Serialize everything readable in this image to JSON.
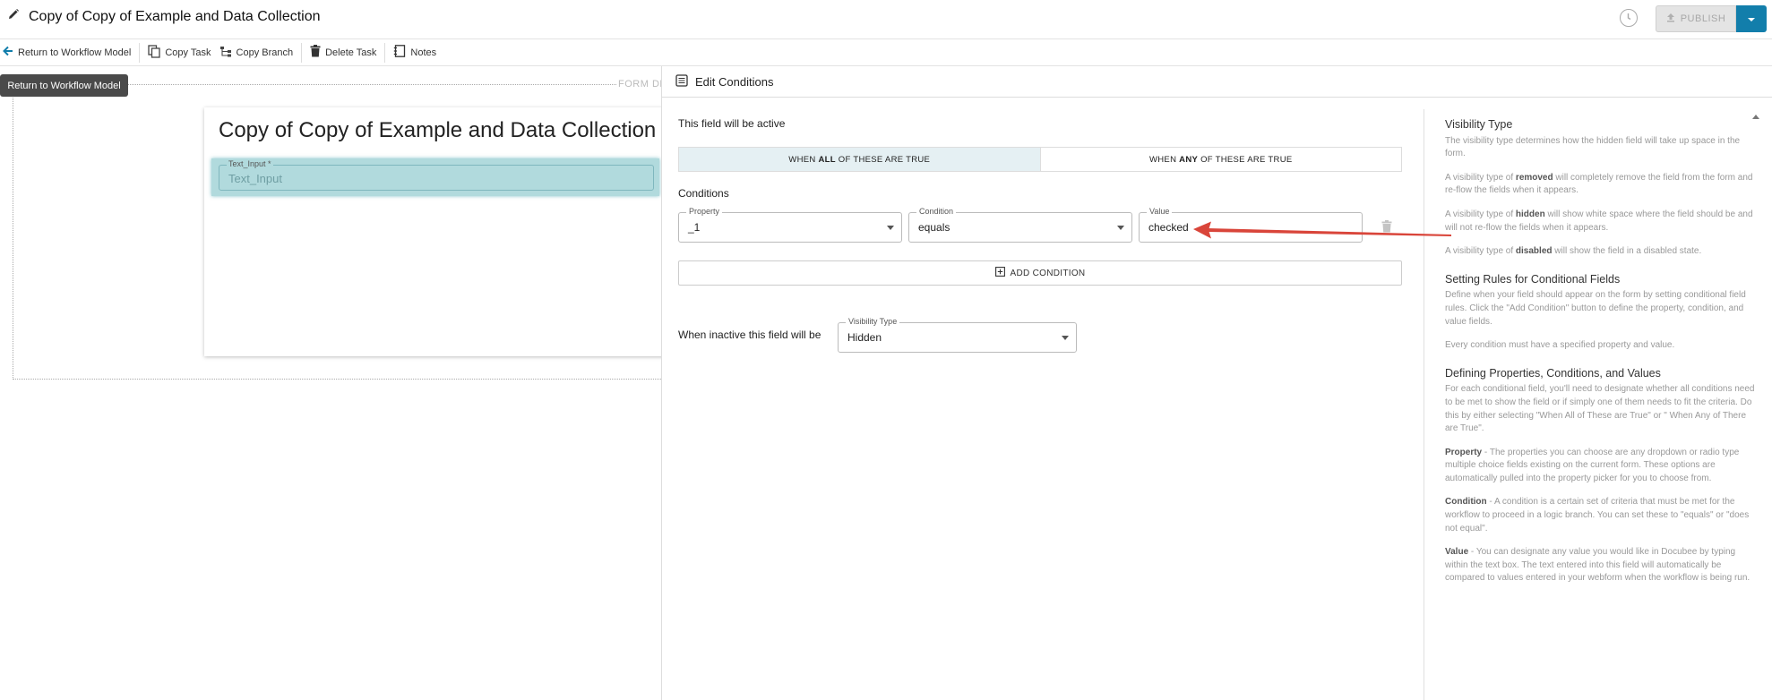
{
  "header": {
    "title": "Copy of Copy of Example and Data Collection",
    "publish_label": "PUBLISH"
  },
  "toolbar": {
    "return_label": "Return to Workflow Model",
    "copy_task_label": "Copy Task",
    "copy_branch_label": "Copy Branch",
    "delete_task_label": "Delete Task",
    "notes_label": "Notes"
  },
  "tooltip": {
    "text": "Return to Workflow Model"
  },
  "canvas": {
    "form_designer_label": "FORM DE",
    "form_title": "Copy of Copy of Example and Data Collection",
    "field_label": "Text_Input *",
    "field_placeholder": "Text_Input"
  },
  "edit_conditions": {
    "title": "Edit Conditions",
    "active_label": "This field will be active",
    "mode_all": {
      "prefix": "WHEN ",
      "bold": "ALL",
      "suffix": " OF THESE ARE TRUE"
    },
    "mode_any": {
      "prefix": "WHEN ",
      "bold": "ANY",
      "suffix": " OF THESE ARE TRUE"
    },
    "selected_mode": "all",
    "conditions_heading": "Conditions",
    "property": {
      "label": "Property",
      "value": "_1"
    },
    "condition": {
      "label": "Condition",
      "value": "equals"
    },
    "value": {
      "label": "Value",
      "value": "checked"
    },
    "add_condition_label": "ADD CONDITION",
    "inactive_label": "When inactive this field will be",
    "visibility": {
      "label": "Visibility Type",
      "value": "Hidden"
    }
  },
  "help": {
    "visibility_title": "Visibility Type",
    "visibility_intro": "The visibility type determines how the hidden field will take up space in the form.",
    "removed": {
      "pre": "A visibility type of ",
      "bold": "removed",
      "post": " will completely remove the field from the form and re-flow the fields when it appears."
    },
    "hidden": {
      "pre": "A visibility type of ",
      "bold": "hidden",
      "post": " will show white space where the field should be and will not re-flow the fields when it appears."
    },
    "disabled": {
      "pre": "A visibility type of ",
      "bold": "disabled",
      "post": " will show the field in a disabled state."
    },
    "rules_title": "Setting Rules for Conditional Fields",
    "rules_text": "Define when your field should appear on the form by setting conditional field rules. Click the \"Add Condition\" button to define the property, condition, and value fields.",
    "rules_note": "Every condition must have a specified property and value.",
    "defining_title": "Defining Properties, Conditions, and Values",
    "defining_text": "For each conditional field, you'll need to designate whether all conditions need to be met to show the field or if simply one of them needs to fit the criteria. Do this by either selecting \"When All of These are True\" or \" When Any of There are True\".",
    "property_term": "Property",
    "property_text": " - The properties you can choose are any dropdown or radio type multiple choice fields existing on the current form. These options are automatically pulled into the property picker for you to choose from.",
    "condition_term": "Condition",
    "condition_text": " - A condition is a certain set of criteria that must be met for the workflow to proceed in a logic branch. You can set these to \"equals\" or \"does not equal\".",
    "value_term": "Value",
    "value_text": " - You can designate any value you would like in Docubee by typing within the text box. The text entered into this field will automatically be compared to values entered in your webform when the workflow is being run."
  },
  "colors": {
    "accent": "#127eab",
    "field_highlight": "#b1dadd",
    "annotation_arrow": "#d9453a",
    "selected_mode_bg": "#e5f0f3"
  }
}
